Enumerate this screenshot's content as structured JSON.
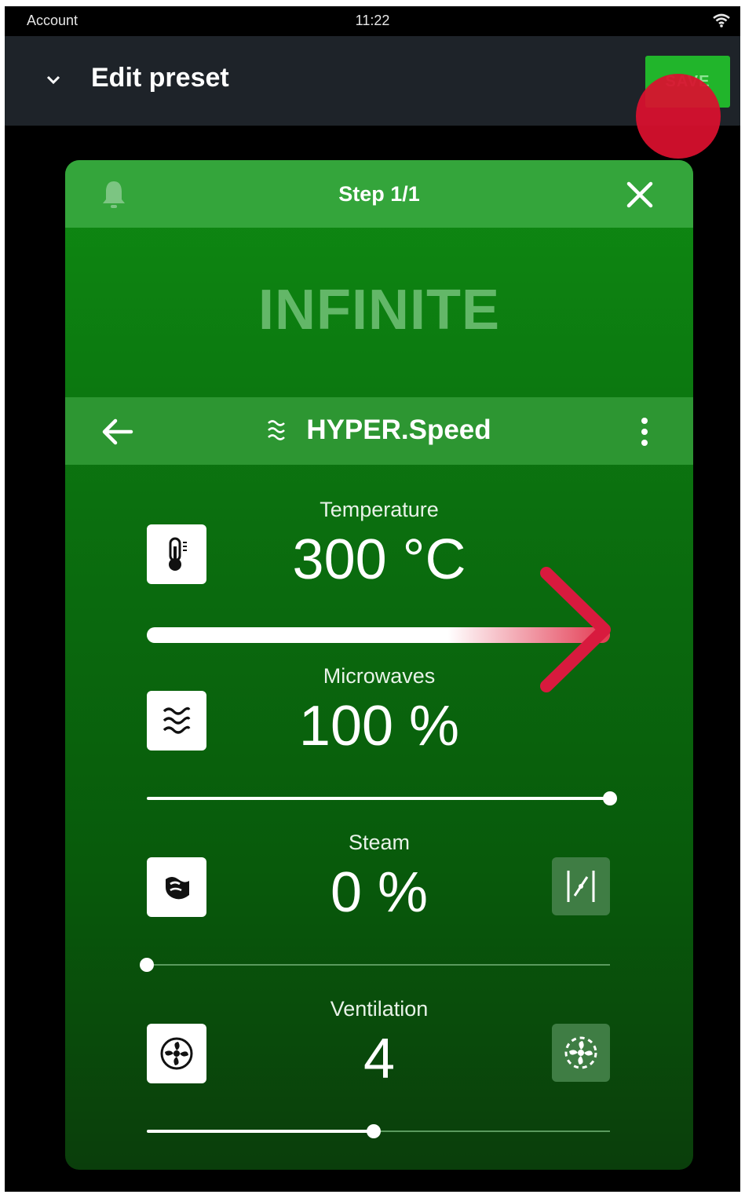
{
  "status_bar": {
    "left_text": "Account",
    "time": "11:22"
  },
  "app_bar": {
    "title": "Edit preset",
    "save_label": "SAVE"
  },
  "step_card": {
    "step_label": "Step 1/1",
    "duration": "INFINITE",
    "mode_label": "HYPER.Speed",
    "params": [
      {
        "label": "Temperature",
        "value": "300 °C",
        "level": 1.0
      },
      {
        "label": "Microwaves",
        "value": "100 %",
        "level": 1.0
      },
      {
        "label": "Steam",
        "value": "0 %",
        "level": 0.0
      },
      {
        "label": "Ventilation",
        "value": "4",
        "level": 0.49
      }
    ]
  },
  "colors": {
    "accent": "#21b52b",
    "card_header": "#34a53b",
    "touch_indicator": "#da102e"
  }
}
